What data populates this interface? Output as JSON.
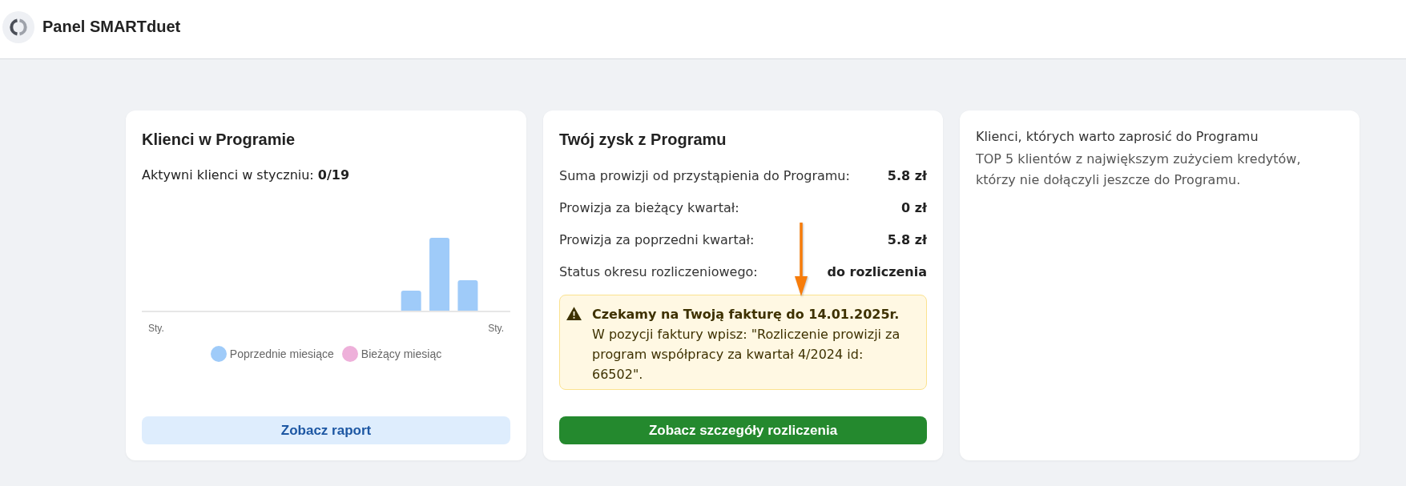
{
  "header": {
    "title": "Panel SMARTduet"
  },
  "cards": [
    {
      "kind": "clients",
      "title": "Klienci w Programie",
      "summary": "Aktywni klienci w styczniu: **0/19**",
      "chart": {
        "x_labels": [
          "Sty.",
          "Sty."
        ],
        "legend": [
          {
            "label": "Poprzednie miesiące",
            "color": "#9fcbf9"
          },
          {
            "label": "Bieżący miesiąc",
            "color": "#eeb0da"
          }
        ]
      },
      "button": {
        "kind": "secondary",
        "label": "Zobacz raport"
      }
    },
    {
      "kind": "earnings",
      "title": "Twój zysk z Programu",
      "rows": [
        {
          "label": "Suma prowizji od przystąpienia do Programu:",
          "value": "5.8 zł"
        },
        {
          "label": "Prowizja za bieżący kwartał:",
          "value": "0 zł"
        },
        {
          "label": "Prowizja za poprzedni kwartał:",
          "value": "5.8 zł"
        },
        {
          "label": "Status okresu rozliczeniowego:",
          "value": "do rozliczenia"
        }
      ],
      "alert": {
        "kind": "warning",
        "title": "Czekamy na Twoją fakturę do 14.01.2025r.",
        "message": "W pozycji faktury wpisz: \"Rozliczenie prowizji za program współpracy za kwartał 4/2024 id: 66502\"."
      },
      "button": {
        "kind": "primary",
        "label": "Zobacz szczegóły rozliczenia"
      }
    },
    {
      "kind": "invite",
      "title": "Klienci, których warto zaprosić do Programu",
      "description": "TOP 5 klientów z największym zużyciem kredytów, którzy nie dołączyli jeszcze do Programu."
    }
  ]
}
